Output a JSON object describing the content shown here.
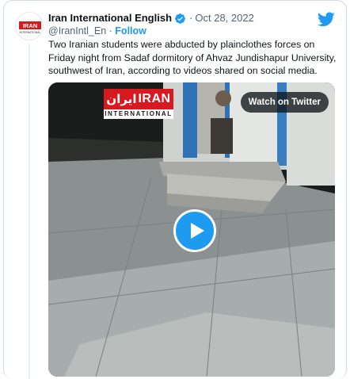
{
  "author": {
    "display_name": "Iran International English",
    "handle": "@IranIntl_En",
    "follow_label": "Follow",
    "avatar_text": "IRAN",
    "avatar_subtext": "INTERNATIONAL"
  },
  "date": "Oct 28, 2022",
  "separator": "·",
  "tweet_text": "Two Iranian students were abducted by plainclothes forces on Friday night from Sadaf dormitory of Ahvaz Jundishapur University, southwest of Iran, according to videos shared on social media.",
  "media": {
    "watch_label": "Watch on Twitter",
    "logo_fa": "ایران",
    "logo_en": "IRAN",
    "logo_sub": "INTERNATIONAL"
  },
  "colors": {
    "twitter_blue": "#1d9bf0",
    "brand_red": "#d71920"
  },
  "icons": {
    "verified": "verified-badge-icon",
    "twitter": "twitter-bird-icon",
    "play": "play-icon"
  }
}
